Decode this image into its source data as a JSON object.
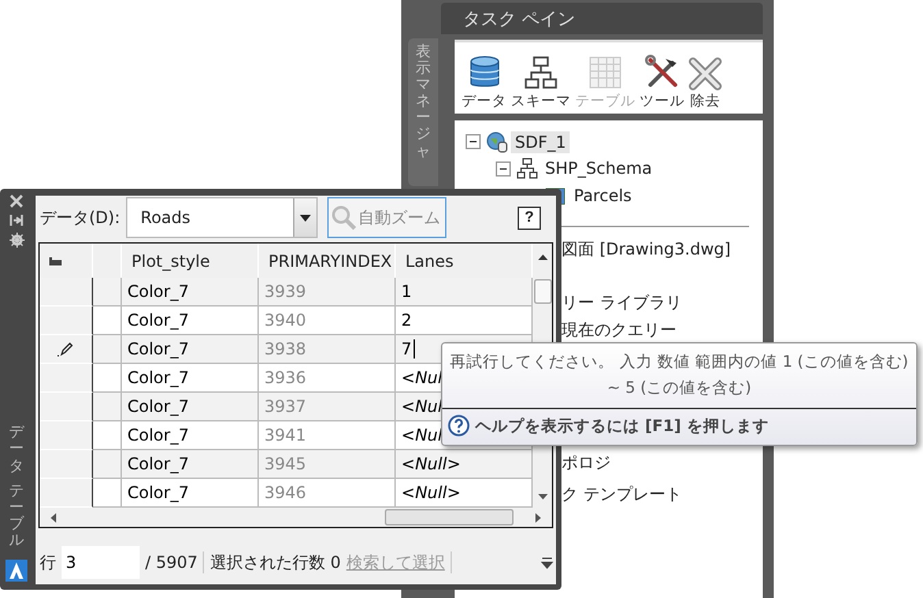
{
  "task_pane": {
    "title": "タスク ペイン",
    "side_tab": "表示マネージャ",
    "toolbar": [
      {
        "label": "データ",
        "disabled": false
      },
      {
        "label": "スキーマ",
        "disabled": false
      },
      {
        "label": "テーブル",
        "disabled": true
      },
      {
        "label": "ツール",
        "disabled": false
      },
      {
        "label": "除去",
        "disabled": false
      }
    ],
    "tree": [
      {
        "label": "SDF_1",
        "kind": "source",
        "expanded": true,
        "selected": true,
        "children": [
          {
            "label": "SHP_Schema",
            "kind": "schema",
            "expanded": true,
            "selected": false,
            "children": [
              {
                "label": "Parcels",
                "kind": "layer",
                "selected": false
              }
            ]
          }
        ]
      }
    ],
    "map_items": [
      "図面 [Drawing3.dwg]",
      "リー ライブラリ",
      "現在のクエリー",
      "ポロジ",
      "ク テンプレート"
    ]
  },
  "data_table": {
    "side_title": [
      "データ",
      "テーブル"
    ],
    "data_label": "データ(D):",
    "source": "Roads",
    "zoom_button": "自動ズーム",
    "help": "?",
    "columns": [
      "Plot_style",
      "PRIMARYINDEX",
      "Lanes"
    ],
    "rows": [
      {
        "cells": [
          "Color_7",
          "3939",
          "1"
        ],
        "editing": false
      },
      {
        "cells": [
          "Color_7",
          "3940",
          "2"
        ],
        "editing": false
      },
      {
        "cells": [
          "Color_7",
          "3938",
          "7"
        ],
        "editing": true
      },
      {
        "cells": [
          "Color_7",
          "3936",
          "<*Nul*"
        ],
        "editing": false
      },
      {
        "cells": [
          "Color_7",
          "3937",
          "<*Nul*"
        ],
        "editing": false
      },
      {
        "cells": [
          "Color_7",
          "3941",
          "<*Nul*"
        ],
        "editing": false
      },
      {
        "cells": [
          "Color_7",
          "3945",
          "<*Null*>"
        ],
        "editing": false
      },
      {
        "cells": [
          "Color_7",
          "3946",
          "<*Null*>"
        ],
        "editing": false
      }
    ],
    "status": {
      "row_label": "行",
      "row_value": "3",
      "total": "/ 5907",
      "selected_count": "選択された行数 0",
      "select_link": "検索して選択"
    }
  },
  "tooltip": {
    "message": "再試行してください。 入力 数値 範囲内の値 1 (この値を含む) ~ 5 (この値を含む)",
    "help": "ヘルプを表示するには [F1] を押します"
  }
}
